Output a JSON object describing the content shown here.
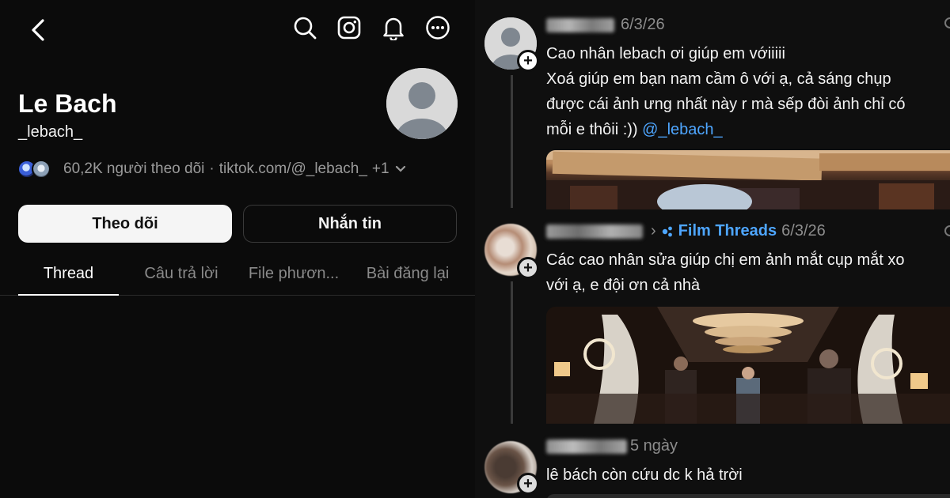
{
  "profile": {
    "name": "Le Bach",
    "handle": "_lebach_",
    "followers_text": "60,2K người theo dõi",
    "separator": "·",
    "link_text": "tiktok.com/@_lebach_",
    "more_links": "+1",
    "follow_label": "Theo dõi",
    "message_label": "Nhắn tin",
    "tabs": [
      {
        "label": "Thread",
        "active": true
      },
      {
        "label": "Câu trả lời",
        "active": false
      },
      {
        "label": "File phươn...",
        "active": false
      },
      {
        "label": "Bài đăng lại",
        "active": false
      }
    ],
    "icons": [
      "back-icon",
      "search-icon",
      "instagram-icon",
      "bell-icon",
      "more-icon"
    ]
  },
  "feed": {
    "posts": [
      {
        "author_blurred": "paul_25",
        "date": "6/3/26",
        "lines": [
          "Cao nhân lebach ơi giúp em vớiiiii",
          "Xoá giúp em bạn nam cầm ô với ạ, cả sáng chụp",
          "được cái ảnh ưng nhất này r mà sếp đòi ảnh chỉ có",
          "mỗi e thôii :))"
        ],
        "mention": "@_lebach_"
      },
      {
        "author_blurred": "booomusuko",
        "arrow": "›",
        "community": "Film Threads",
        "date": "6/3/26",
        "lines": [
          "Các cao nhân sửa giúp chị em ảnh mắt cụp mắt xo",
          "với ạ, e đội ơn cả nhà"
        ]
      },
      {
        "author_blurred": "hihyyyeee",
        "date": "5 ngày",
        "lines": [
          "lê bách còn cứu dc k hả trời"
        ]
      }
    ]
  },
  "colors": {
    "background": "#0b0b0b",
    "accent_blue": "#4ea6ff",
    "muted_text": "#8d8d8d"
  }
}
